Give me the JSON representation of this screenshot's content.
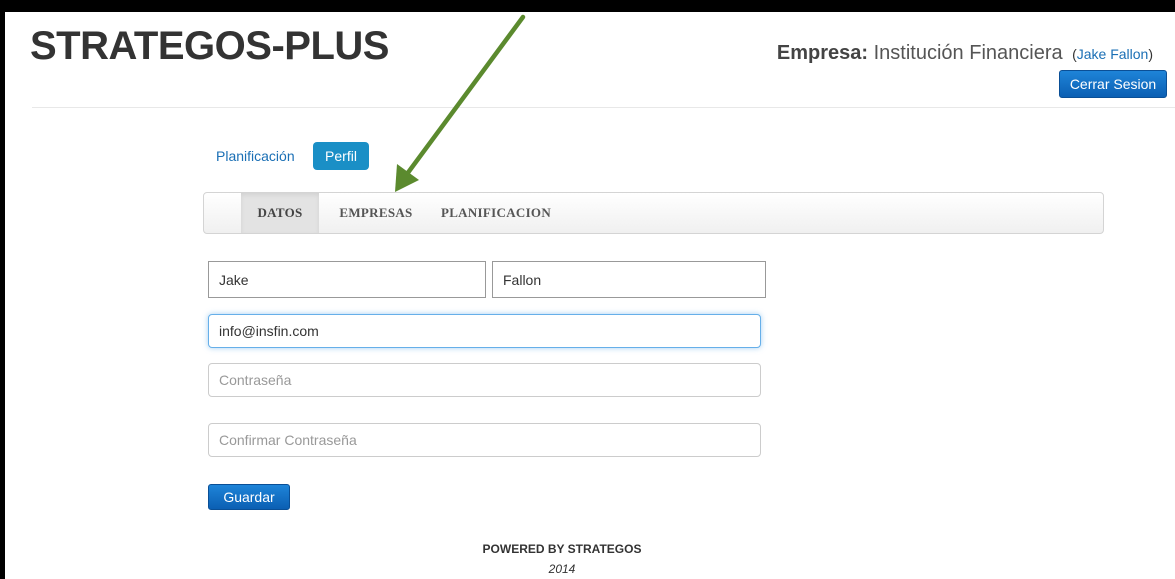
{
  "header": {
    "brand": "STRATEGOS-PLUS",
    "company_label": "Empresa:",
    "company_name": "Institución Financiera",
    "user_open": "(",
    "user_name": "Jake Fallon",
    "user_close": ")",
    "logout_label": "Cerrar Sesion"
  },
  "pills": {
    "planificacion": "Planificación",
    "perfil": "Perfil"
  },
  "tabs": [
    {
      "label": "DATOS",
      "active": true
    },
    {
      "label": "EMPRESAS",
      "active": false
    },
    {
      "label": "PLANIFICACION",
      "active": false
    }
  ],
  "form": {
    "first_name": "Jake",
    "last_name": "Fallon",
    "email": "info@insfin.com",
    "password_placeholder": "Contraseña",
    "confirm_placeholder": "Confirmar Contraseña",
    "save_label": "Guardar"
  },
  "footer": {
    "powered": "POWERED BY STRATEGOS",
    "year": "2014"
  },
  "colors": {
    "accent": "#1a8fc6",
    "primary": "#0b5fb3",
    "annotation_arrow": "#5b8a2e"
  }
}
